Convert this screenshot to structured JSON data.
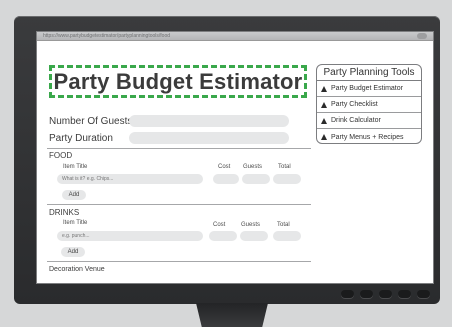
{
  "browser": {
    "url": "https://www.partybudgetestimator/partyplanningtools/food"
  },
  "header": {
    "title": "Party Budget Estimator"
  },
  "tools_panel": {
    "title": "Party Planning Tools",
    "items": [
      {
        "label": "Party Budget Estimator",
        "icon": "triangle-icon"
      },
      {
        "label": "Party Checklist",
        "icon": "triangle-icon"
      },
      {
        "label": "Drink Calculator",
        "icon": "triangle-icon"
      },
      {
        "label": "Party Menus + Recipes",
        "icon": "triangle-icon"
      }
    ]
  },
  "fields": {
    "guests_label": "Number Of Guests",
    "guests_value": "",
    "duration_label": "Party Duration",
    "duration_value": ""
  },
  "food": {
    "section_label": "FOOD",
    "item_title_label": "Item Title",
    "item_placeholder": "What is it? e.g. Chips...",
    "cost_label": "Cost",
    "guests_label": "Guests",
    "total_label": "Total",
    "add_label": "Add"
  },
  "drinks": {
    "section_label": "DRINKS",
    "item_title_label": "Item Title",
    "item_placeholder": "e.g. punch...",
    "cost_label": "Cost",
    "guests_label": "Guests",
    "total_label": "Total",
    "add_label": "Add"
  },
  "bottom": {
    "label": "Decoration Venue"
  },
  "colors": {
    "title_border": "#3aa84b",
    "input_fill": "#e6e7e8",
    "monitor": "#2f3032"
  }
}
